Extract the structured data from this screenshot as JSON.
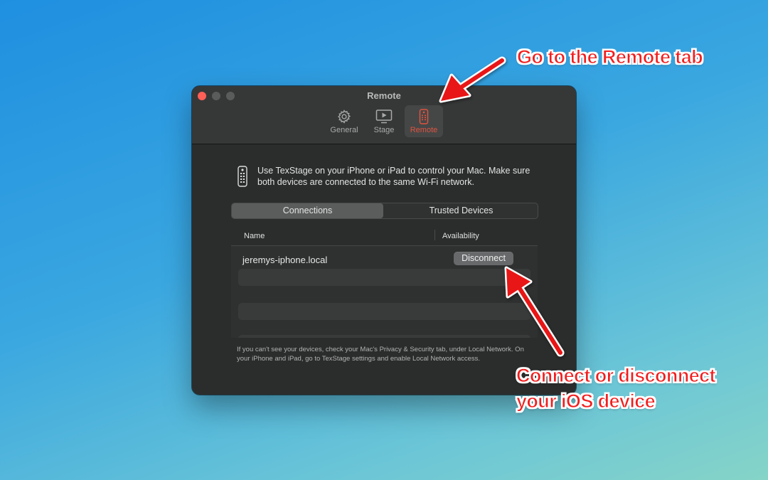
{
  "window": {
    "title": "Remote",
    "toolbar_tabs": [
      {
        "label": "General",
        "icon": "gear-icon"
      },
      {
        "label": "Stage",
        "icon": "stage-icon"
      },
      {
        "label": "Remote",
        "icon": "remote-icon",
        "selected": true
      }
    ]
  },
  "info": {
    "icon": "remote-icon",
    "text": "Use TexStage on your iPhone or iPad to control your Mac. Make sure both devices are connected to the same Wi-Fi network."
  },
  "segments": {
    "connections": "Connections",
    "trusted": "Trusted Devices",
    "selected": "Connections"
  },
  "table": {
    "columns": [
      "Name",
      "Availability"
    ],
    "rows": [
      {
        "name": "jeremys-iphone.local",
        "action": "Disconnect"
      }
    ]
  },
  "footer": "If you can't see your devices, check your Mac's Privacy & Security tab, under Local Network. On your iPhone and iPad, go to TexStage settings and enable Local Network access.",
  "annotations": {
    "top": "Go to the Remote tab",
    "bottom_line1": "Connect or disconnect",
    "bottom_line2": "your iOS device"
  },
  "colors": {
    "accent_selected": "#e0533f",
    "annotation_red": "#f21d1d",
    "close_button": "#fe5f57"
  }
}
